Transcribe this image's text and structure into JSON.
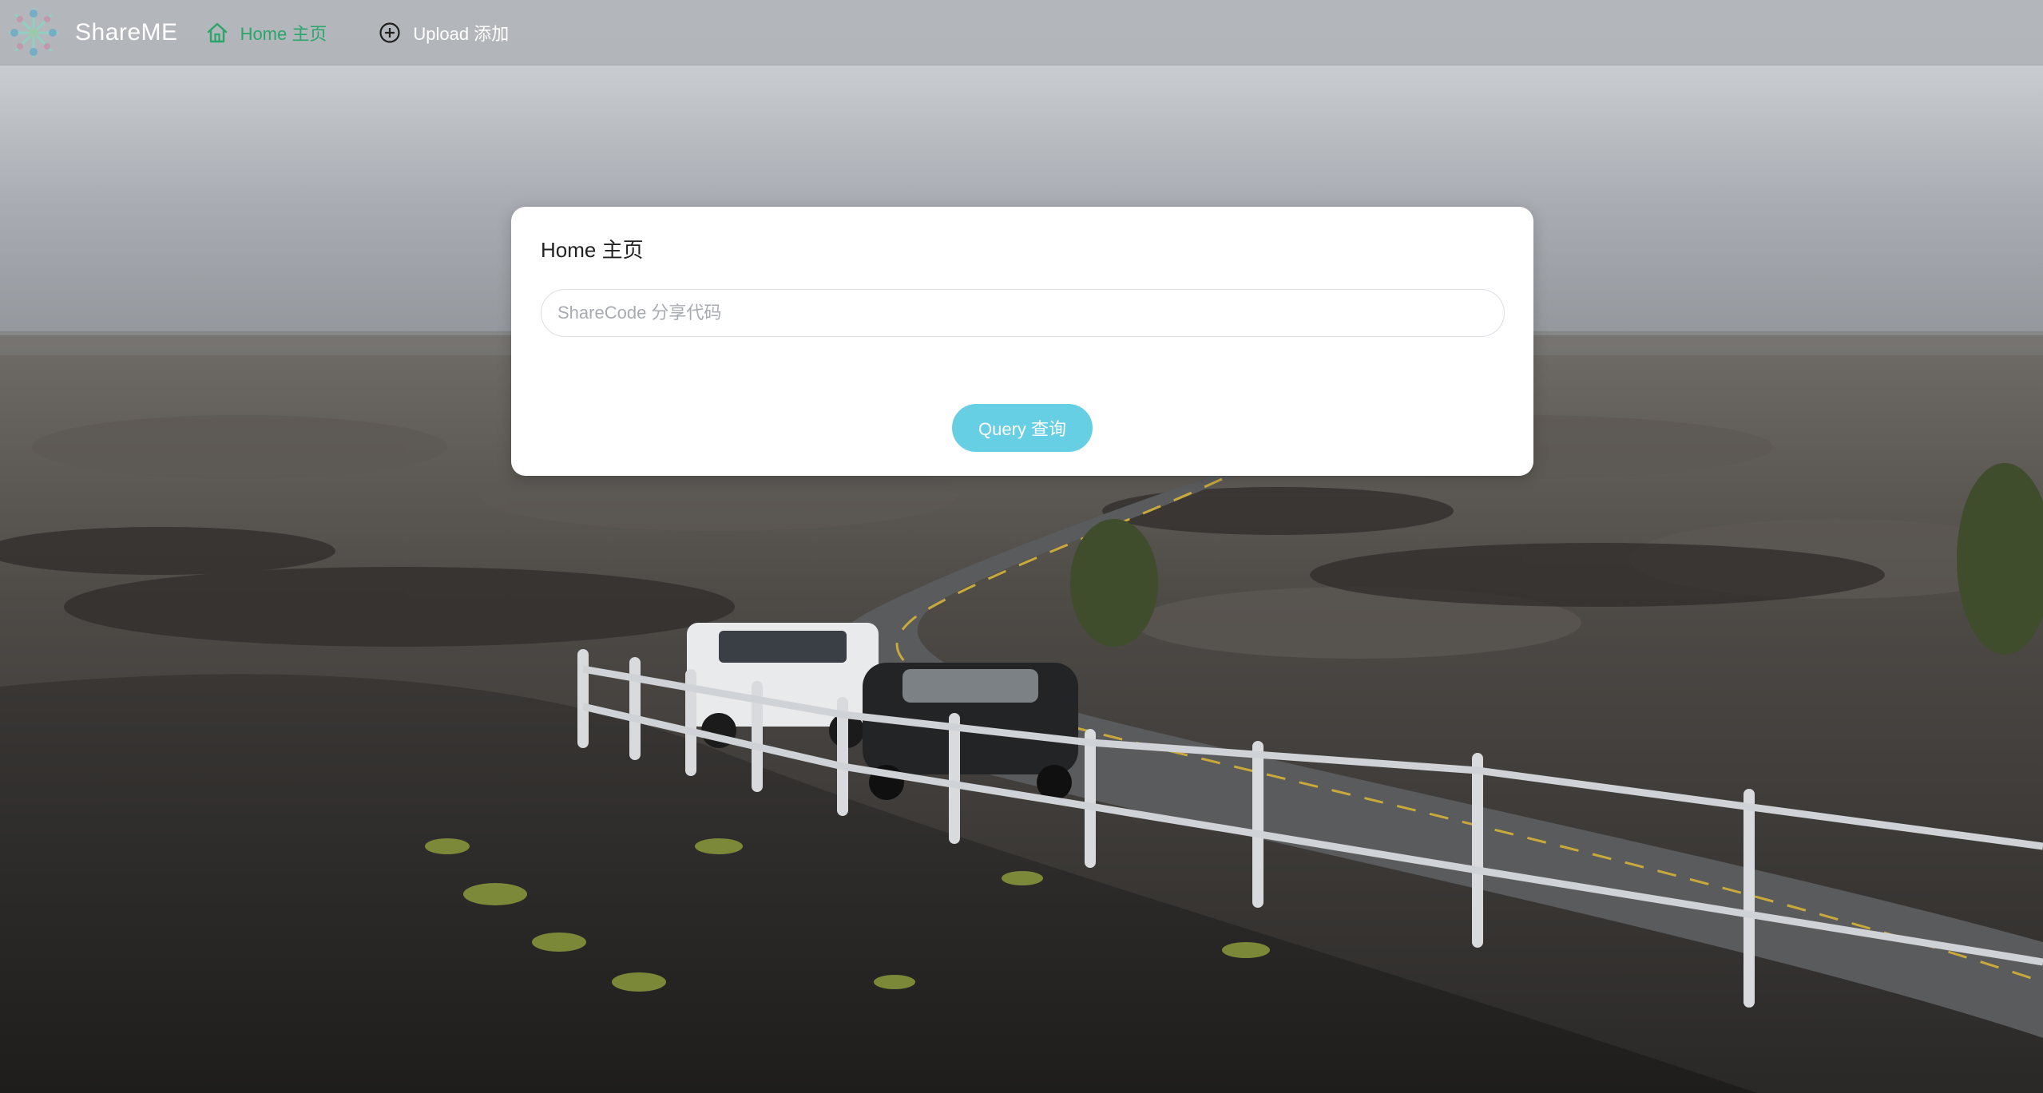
{
  "app": {
    "brand_name": "ShareME",
    "logo_icon": "snowflake-logo-icon"
  },
  "nav": {
    "home_label": "Home 主页",
    "home_icon": "home-icon",
    "upload_label": "Upload 添加",
    "upload_icon": "plus-circle-icon",
    "active_color": "#2aa66a"
  },
  "card": {
    "title": "Home 主页",
    "sharecode_input": {
      "value": "",
      "placeholder": "ShareCode 分享代码"
    },
    "query_button_label": "Query 查询",
    "query_button_color": "#67cfe3"
  },
  "background": {
    "scene": "lava-field-road-photo"
  }
}
